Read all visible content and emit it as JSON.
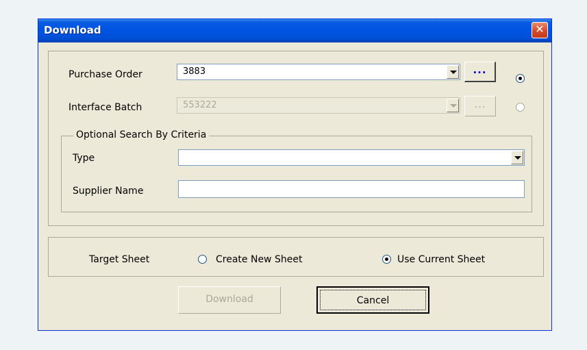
{
  "window": {
    "title": "Download",
    "close_glyph": "✕"
  },
  "selection": {
    "purchase_order_label": "Purchase Order",
    "purchase_order_value": "3883",
    "purchase_order_browse": "...",
    "interface_batch_label": "Interface Batch",
    "interface_batch_value": "553222",
    "interface_batch_browse": "...",
    "selected_mode": "purchase_order"
  },
  "criteria": {
    "legend": "Optional Search By Criteria",
    "type_label": "Type",
    "type_value": "",
    "supplier_label": "Supplier Name",
    "supplier_value": ""
  },
  "target": {
    "label": "Target Sheet",
    "create_new_label": "Create New Sheet",
    "use_current_label": "Use Current Sheet",
    "selected": "use_current"
  },
  "buttons": {
    "download_label": "Download",
    "cancel_label": "Cancel"
  },
  "colors": {
    "title_bar": "#0054e3",
    "window_bg": "#ece9d8",
    "close_button": "#d5492a",
    "browse_dots": "#0000c8"
  }
}
